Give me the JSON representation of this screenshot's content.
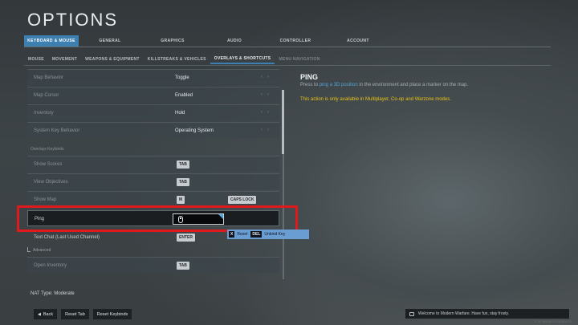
{
  "title": "OPTIONS",
  "main_tabs": [
    {
      "label": "KEYBOARD & MOUSE",
      "active": true
    },
    {
      "label": "GENERAL"
    },
    {
      "label": "GRAPHICS"
    },
    {
      "label": "AUDIO"
    },
    {
      "label": "CONTROLLER"
    },
    {
      "label": "ACCOUNT"
    }
  ],
  "sub_tabs": [
    {
      "label": "MOUSE"
    },
    {
      "label": "MOVEMENT"
    },
    {
      "label": "WEAPONS & EQUIPMENT"
    },
    {
      "label": "KILLSTREAKS & VEHICLES"
    },
    {
      "label": "OVERLAYS & SHORTCUTS",
      "active": true
    },
    {
      "label": "MENU NAVIGATION"
    }
  ],
  "settings": [
    {
      "label": "Map Behavior",
      "value": "Toggle"
    },
    {
      "label": "Map Cursor",
      "value": "Enabled"
    },
    {
      "label": "Inventory",
      "value": "Hold"
    },
    {
      "label": "System Key Behavior",
      "value": "Operating System"
    }
  ],
  "section_label": "Overlays Keybinds",
  "keybinds": [
    {
      "label": "Show Scores",
      "key1": "TAB"
    },
    {
      "label": "View Objectives",
      "key1": "TAB"
    },
    {
      "label": "Show Map",
      "key1": "M",
      "key2": "CAPS LOCK"
    },
    {
      "label": "Ping",
      "key1_icon": "mouse-icon",
      "selected": true
    },
    {
      "label": "Text Chat (Last Used Channel)",
      "key1": "ENTER"
    },
    {
      "label": "Open Inventory",
      "key1": "TAB"
    }
  ],
  "advanced_label": "Advanced",
  "tooltip": {
    "reset_key": "X",
    "reset_label": "Reset",
    "unbind_key": "DEL",
    "unbind_label": "Unbind Key"
  },
  "detail": {
    "title": "PING",
    "desc_before": "Press to ",
    "desc_link": "ping a 3D position",
    "desc_after": " in the environment and place a marker on the map.",
    "note": "This action is only available in Multiplayer, Co-op and Warzone modes."
  },
  "nat_type": "NAT Type: Moderate",
  "bottom_buttons": {
    "back": "Back",
    "reset_tab": "Reset Tab",
    "reset_keybinds": "Reset Keybinds"
  },
  "welcome_message": "Welcome to Modern Warfare. Have fun, stay frosty.",
  "version_text": "8.18.7909261 [1.6.6] 80:4 1.0",
  "colors": {
    "accent": "#3d7fb1",
    "highlight": "#e0191c",
    "note": "#e6c21a",
    "link": "#4fa3d8"
  }
}
